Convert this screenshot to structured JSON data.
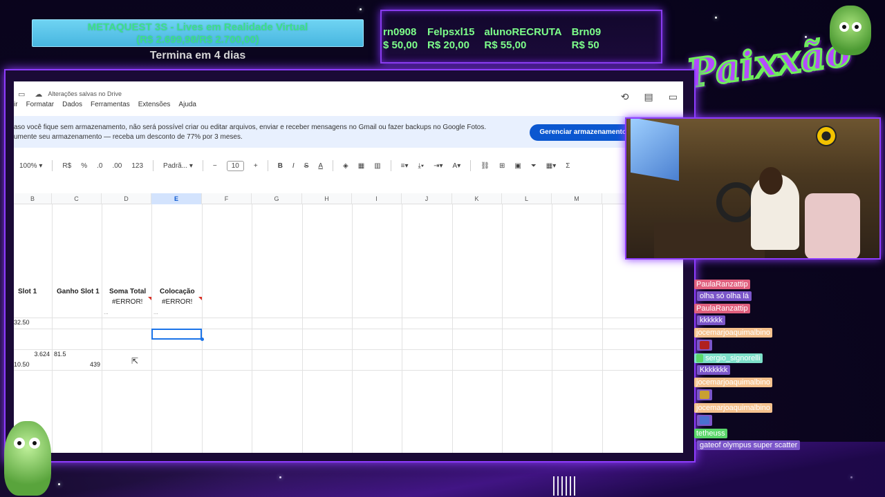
{
  "goal": {
    "title": "METAQUEST 3S - Lives em Realidade Virtual",
    "progress": "(R$ 2.699,98/R$ 2.700,00)",
    "ends_in": "Termina em 4 dias",
    "fraction": 0.99999
  },
  "ticker": [
    {
      "name": "rn0908",
      "amount": "$ 50,00"
    },
    {
      "name": "Felpsxl15",
      "amount": "R$ 20,00"
    },
    {
      "name": "alunoRECRUTA",
      "amount": "R$ 55,00"
    },
    {
      "name": "Brn09",
      "amount": "R$ 50"
    }
  ],
  "logo": {
    "text": "Paixxão"
  },
  "sheets": {
    "drive_status": "Alterações salvas no Drive",
    "menu": [
      "ir",
      "Formatar",
      "Dados",
      "Ferramentas",
      "Extensões",
      "Ajuda"
    ],
    "banner_line1": "aso você fique sem armazenamento, não será possível criar ou editar arquivos, enviar e receber mensagens no Gmail ou fazer backups no Google Fotos.",
    "banner_line2": "umente seu armazenamento — receba um desconto de 77% por 3 meses.",
    "banner_button": "Gerenciar armazenamento",
    "toolbar": {
      "zoom": "100%",
      "currency": "R$",
      "percent": "%",
      "dec_decrease": ".0",
      "dec_increase": ".00",
      "format_123": "123",
      "font": "Padrã...",
      "font_size": "10",
      "minus": "−",
      "plus": "+",
      "bold": "B",
      "italic": "I",
      "strike": "S",
      "text_color": "A",
      "sigma": "Σ"
    },
    "columns": [
      "B",
      "C",
      "D",
      "E",
      "F",
      "G",
      "H",
      "I",
      "J",
      "K",
      "L",
      "M"
    ],
    "headers": {
      "B": "Slot 1",
      "C": "Ganho Slot 1",
      "D": "Soma Total",
      "E": "Colocação"
    },
    "errors": {
      "D": "#ERROR!",
      "E": "#ERROR!"
    },
    "ellipsis": "...",
    "values": {
      "b_row4": "32.50",
      "b_row7": "3.624",
      "c_row7": "81.5",
      "b_row8": "10.50",
      "c_row8": "439"
    }
  },
  "chat": [
    {
      "user": "PaulaRanzattip",
      "color": "#e0607e",
      "message": "olha só olha lá"
    },
    {
      "user": "PaulaRanzattip",
      "color": "#e0607e",
      "message": "kkkkkk"
    },
    {
      "user": "jocemarjoaquimalbino",
      "color": "#f5c28e",
      "message": ""
    },
    {
      "user": "sergio_signorelli",
      "color": "#7de0c9",
      "message": "Kkkkkkk"
    },
    {
      "user": "jocemarjoaquimalbino",
      "color": "#f5c28e",
      "message": ""
    },
    {
      "user": "jocemarjoaquimalbino",
      "color": "#f5c28e",
      "message": ""
    },
    {
      "user": "tetheuss",
      "color": "#5ad76a",
      "message": "gateof olympus super scatter"
    }
  ],
  "colors": {
    "accent_purple": "#8e3cff",
    "ticker_green": "#7dff8a",
    "sheets_blue": "#0b57d0"
  }
}
